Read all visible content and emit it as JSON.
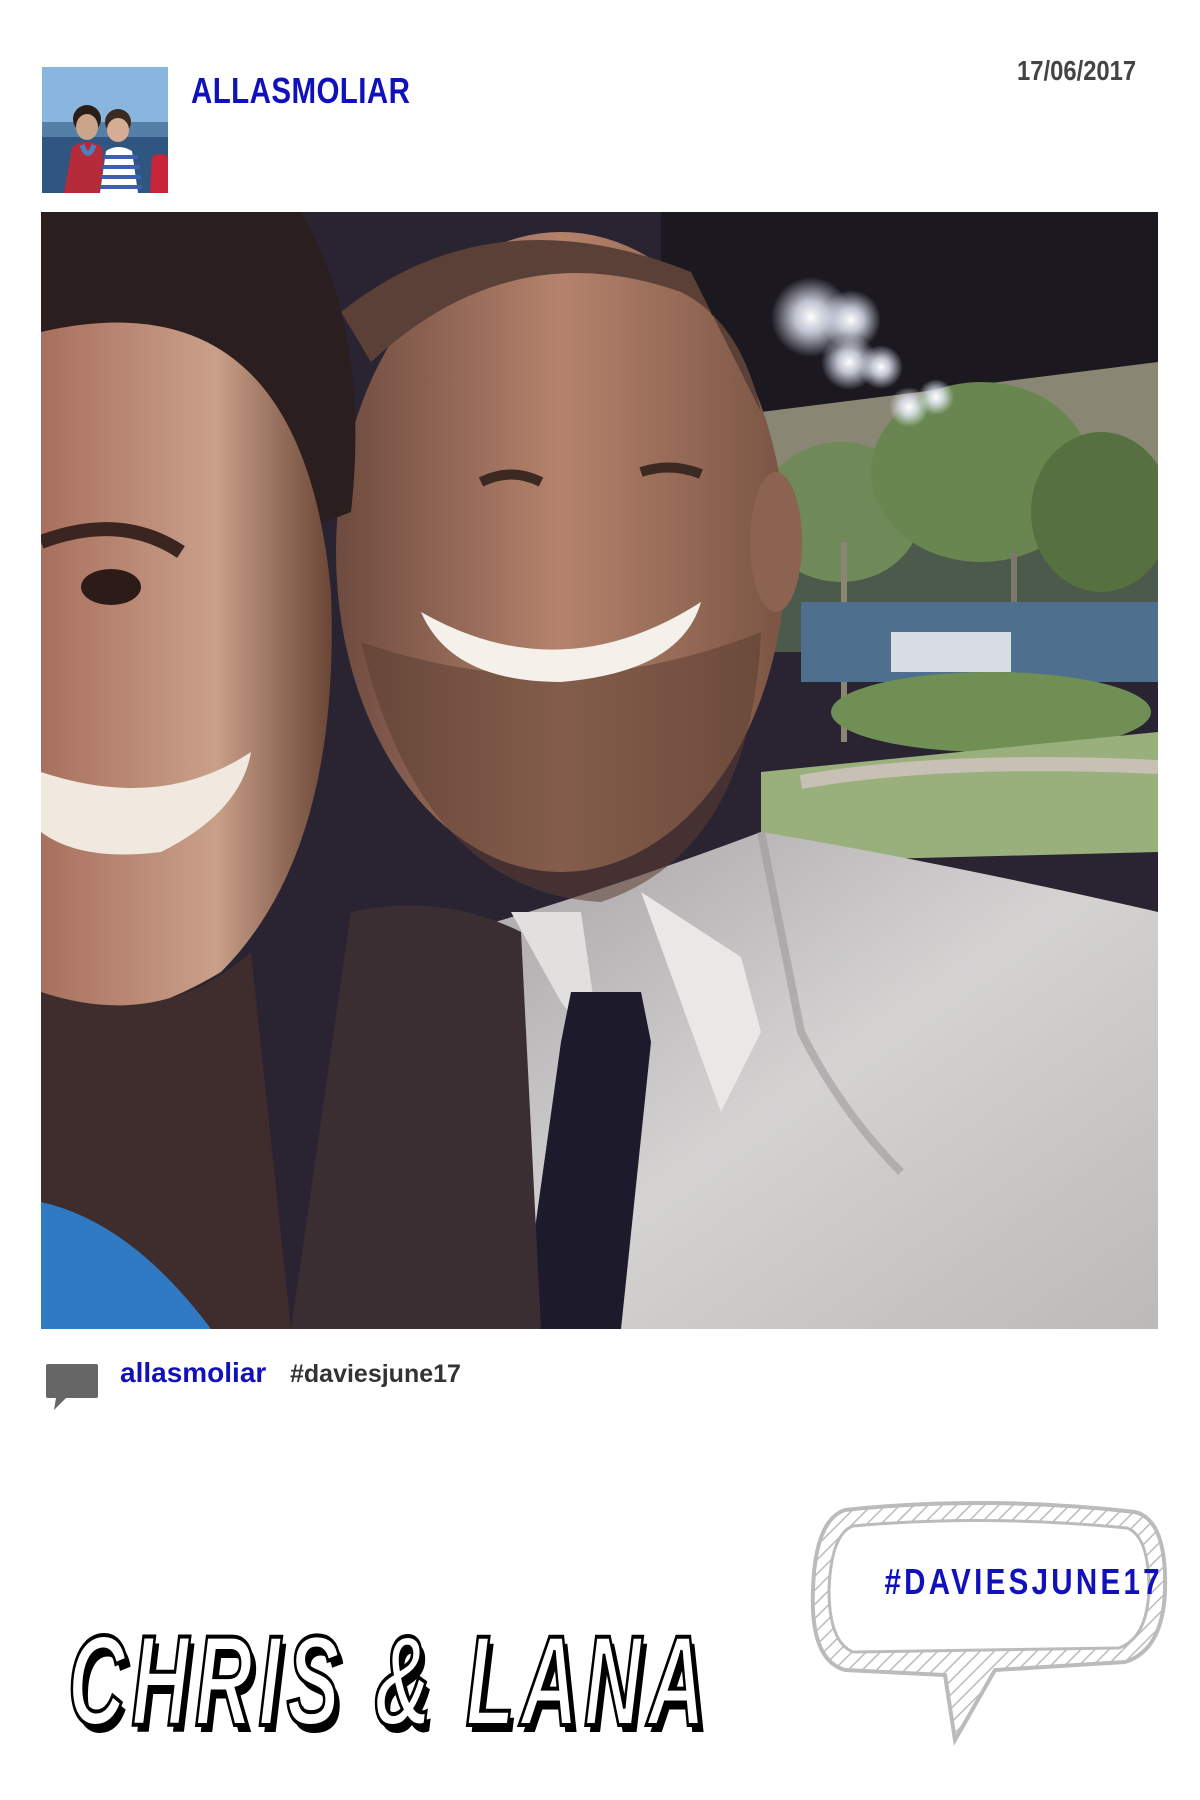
{
  "post": {
    "username": "ALLASMOLIAR",
    "date": "17/06/2017"
  },
  "comment": {
    "username": "allasmoliar",
    "hashtag": "#daviesjune17"
  },
  "footer": {
    "bubble_hashtag": "#DAVIESJUNE17",
    "title": "CHRIS & LANA"
  },
  "colors": {
    "brand_blue": "#1111bb",
    "text_gray": "#444444",
    "icon_gray": "#666666"
  }
}
